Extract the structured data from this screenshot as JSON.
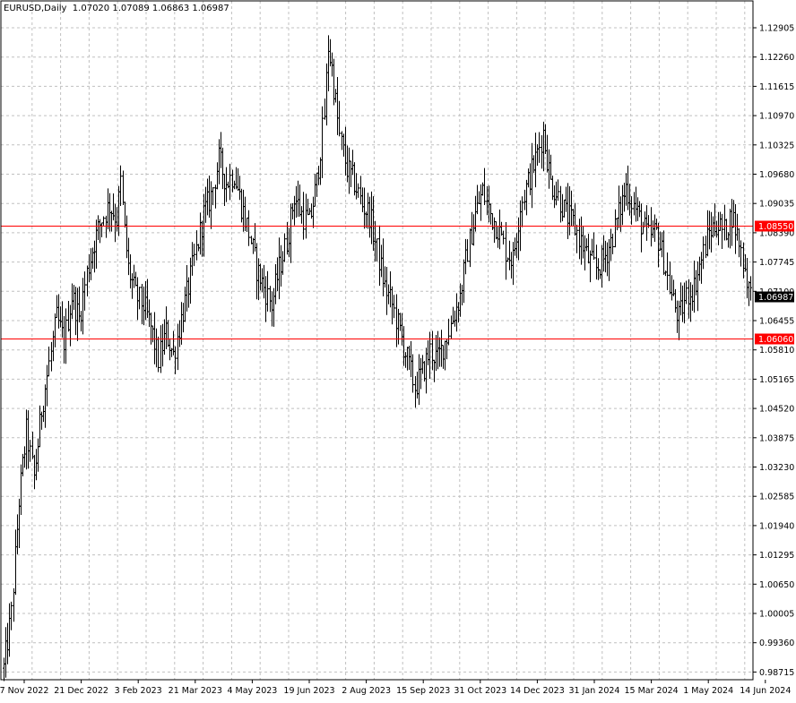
{
  "header": {
    "symbol": "EURUSD,Daily",
    "ohlc": "1.07020 1.07089 1.06863 1.06987"
  },
  "colors": {
    "background": "#ffffff",
    "bars": "#000000",
    "grid": "#c0c0c0",
    "level_line": "#ff0000",
    "current_price_bg": "#000000"
  },
  "chart_data": {
    "type": "ohlc-bar",
    "symbol": "EURUSD",
    "timeframe": "Daily",
    "ylim": [
      0.9871,
      1.129
    ],
    "y_ticks": [
      "1.12905",
      "1.12260",
      "1.11615",
      "1.10970",
      "1.10325",
      "1.09680",
      "1.09035",
      "1.08390",
      "1.07745",
      "1.07100",
      "1.06455",
      "1.05810",
      "1.05165",
      "1.04520",
      "1.03875",
      "1.03230",
      "1.02585",
      "1.01940",
      "1.01295",
      "1.00650",
      "1.00005",
      "0.99360",
      "0.98715"
    ],
    "x_ticks": [
      "7 Nov 2022",
      "21 Dec 2022",
      "3 Feb 2023",
      "21 Mar 2023",
      "4 May 2023",
      "19 Jun 2023",
      "2 Aug 2023",
      "15 Sep 2023",
      "31 Oct 2023",
      "14 Dec 2023",
      "31 Jan 2024",
      "15 Mar 2024",
      "1 May 2024",
      "14 Jun 2024"
    ],
    "grid": true,
    "levels": [
      {
        "label": "1.08550",
        "value": 1.0855
      },
      {
        "label": "1.06060",
        "value": 1.0606
      }
    ],
    "current_price": {
      "label": "1.06987",
      "value": 1.06987
    },
    "close_path": [
      [
        0,
        0.988
      ],
      [
        4,
        1.0
      ],
      [
        8,
        1.025
      ],
      [
        12,
        1.04
      ],
      [
        16,
        1.03
      ],
      [
        20,
        1.045
      ],
      [
        24,
        1.055
      ],
      [
        28,
        1.065
      ],
      [
        32,
        1.06
      ],
      [
        36,
        1.07
      ],
      [
        40,
        1.065
      ],
      [
        44,
        1.075
      ],
      [
        48,
        1.082
      ],
      [
        52,
        1.087
      ],
      [
        56,
        1.09
      ],
      [
        60,
        1.087
      ],
      [
        62,
        1.095
      ],
      [
        64,
        1.084
      ],
      [
        66,
        1.076
      ],
      [
        70,
        1.07
      ],
      [
        74,
        1.068
      ],
      [
        78,
        1.063
      ],
      [
        82,
        1.056
      ],
      [
        86,
        1.062
      ],
      [
        90,
        1.057
      ],
      [
        94,
        1.065
      ],
      [
        98,
        1.072
      ],
      [
        102,
        1.08
      ],
      [
        106,
        1.088
      ],
      [
        110,
        1.092
      ],
      [
        114,
        1.1
      ],
      [
        118,
        1.095
      ],
      [
        122,
        1.097
      ],
      [
        126,
        1.09
      ],
      [
        130,
        1.084
      ],
      [
        134,
        1.076
      ],
      [
        138,
        1.072
      ],
      [
        142,
        1.068
      ],
      [
        146,
        1.076
      ],
      [
        150,
        1.082
      ],
      [
        154,
        1.092
      ],
      [
        158,
        1.088
      ],
      [
        162,
        1.086
      ],
      [
        166,
        1.095
      ],
      [
        170,
        1.11
      ],
      [
        172,
        1.125
      ],
      [
        174,
        1.12
      ],
      [
        178,
        1.105
      ],
      [
        182,
        1.098
      ],
      [
        186,
        1.095
      ],
      [
        190,
        1.09
      ],
      [
        194,
        1.088
      ],
      [
        198,
        1.08
      ],
      [
        202,
        1.072
      ],
      [
        206,
        1.068
      ],
      [
        210,
        1.062
      ],
      [
        214,
        1.056
      ],
      [
        218,
        1.05
      ],
      [
        222,
        1.053
      ],
      [
        226,
        1.058
      ],
      [
        230,
        1.056
      ],
      [
        234,
        1.06
      ],
      [
        238,
        1.065
      ],
      [
        242,
        1.07
      ],
      [
        246,
        1.08
      ],
      [
        250,
        1.088
      ],
      [
        254,
        1.093
      ],
      [
        258,
        1.088
      ],
      [
        262,
        1.085
      ],
      [
        266,
        1.08
      ],
      [
        270,
        1.078
      ],
      [
        274,
        1.09
      ],
      [
        278,
        1.095
      ],
      [
        282,
        1.1
      ],
      [
        286,
        1.106
      ],
      [
        290,
        1.095
      ],
      [
        294,
        1.092
      ],
      [
        298,
        1.088
      ],
      [
        302,
        1.086
      ],
      [
        306,
        1.082
      ],
      [
        310,
        1.078
      ],
      [
        314,
        1.076
      ],
      [
        318,
        1.078
      ],
      [
        322,
        1.082
      ],
      [
        326,
        1.088
      ],
      [
        330,
        1.094
      ],
      [
        334,
        1.09
      ],
      [
        338,
        1.086
      ],
      [
        342,
        1.083
      ],
      [
        346,
        1.084
      ],
      [
        350,
        1.078
      ],
      [
        354,
        1.07
      ],
      [
        358,
        1.065
      ],
      [
        362,
        1.07
      ],
      [
        366,
        1.072
      ],
      [
        370,
        1.078
      ],
      [
        374,
        1.084
      ],
      [
        378,
        1.086
      ],
      [
        382,
        1.084
      ],
      [
        386,
        1.088
      ],
      [
        390,
        1.082
      ],
      [
        394,
        1.074
      ],
      [
        396,
        1.07
      ]
    ]
  }
}
